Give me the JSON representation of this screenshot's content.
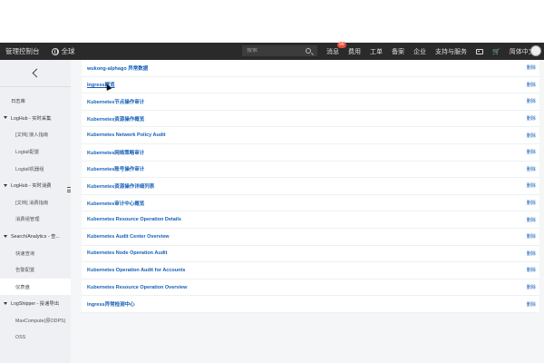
{
  "header": {
    "brand": "管理控制台",
    "region": "全球",
    "search_placeholder": "搜索",
    "nav": [
      {
        "label": "消息",
        "badge": "99"
      },
      {
        "label": "费用"
      },
      {
        "label": "工单"
      },
      {
        "label": "备案"
      },
      {
        "label": "企业"
      },
      {
        "label": "支持与服务"
      }
    ],
    "language": "简体中文"
  },
  "sidebar": {
    "items": [
      {
        "label": "日志库",
        "kind": "top"
      },
      {
        "label": "LogHub - 实时采集",
        "kind": "group"
      },
      {
        "label": "[文档] 接入指南",
        "kind": "child"
      },
      {
        "label": "Logtail配置",
        "kind": "child"
      },
      {
        "label": "Logtail机器组",
        "kind": "child"
      },
      {
        "label": "LogHub - 实时消费",
        "kind": "group"
      },
      {
        "label": "[文档] 消费指南",
        "kind": "child"
      },
      {
        "label": "消费组管理",
        "kind": "child"
      },
      {
        "label": "Search/Analytics - 查...",
        "kind": "group"
      },
      {
        "label": "快速查询",
        "kind": "child"
      },
      {
        "label": "告警配置",
        "kind": "child"
      },
      {
        "label": "仪表盘",
        "kind": "child",
        "active": true
      },
      {
        "label": "LogShipper - 投递导出",
        "kind": "group"
      },
      {
        "label": "MaxCompute(原ODPS)",
        "kind": "child"
      },
      {
        "label": "OSS",
        "kind": "child"
      }
    ]
  },
  "list": {
    "rows": [
      {
        "name": "wukong-alphago 异常数据",
        "action": "删除"
      },
      {
        "name": "Ingress概览",
        "action": "删除",
        "hover": true
      },
      {
        "name": "Kubernetes节点操作审计",
        "action": "删除"
      },
      {
        "name": "Kubernetes资源操作概览",
        "action": "删除"
      },
      {
        "name": "Kubernetes Network Policy Audit",
        "action": "删除"
      },
      {
        "name": "Kubernetes网络策略审计",
        "action": "删除"
      },
      {
        "name": "Kubernetes账号操作审计",
        "action": "删除"
      },
      {
        "name": "Kubernetes资源操作详细列表",
        "action": "删除"
      },
      {
        "name": "Kubernetes审计中心概览",
        "action": "删除"
      },
      {
        "name": "Kubernetes Resource Operation Details",
        "action": "删除"
      },
      {
        "name": "Kubernetes Audit Center Overview",
        "action": "删除"
      },
      {
        "name": "Kubernetes Node Operation Audit",
        "action": "删除"
      },
      {
        "name": "Kubernetes Operation Audit for Accounts",
        "action": "删除"
      },
      {
        "name": "Kubernetes Resource Operation Overview",
        "action": "删除"
      },
      {
        "name": "Ingress异常检测中心",
        "action": "删除"
      }
    ]
  },
  "colors": {
    "topbar": "#2a2a2a",
    "link": "#1560b8",
    "sidebar_bg": "#eef0f3",
    "badge": "#e74c3c"
  }
}
